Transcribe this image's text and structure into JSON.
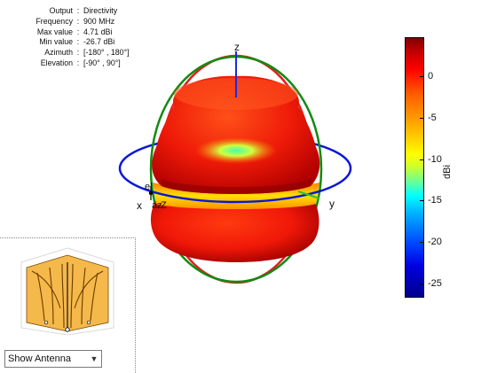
{
  "info": {
    "rows": [
      {
        "key": "Output",
        "sep": ":",
        "value": "Directivity"
      },
      {
        "key": "Frequency",
        "sep": ":",
        "value": "900 MHz"
      },
      {
        "key": "Max value",
        "sep": ":",
        "value": "4.71 dBi"
      },
      {
        "key": "Min value",
        "sep": ":",
        "value": "-26.7 dBi"
      },
      {
        "key": "Azimuth",
        "sep": ":",
        "value": "[-180° , 180°]"
      },
      {
        "key": "Elevation",
        "sep": ":",
        "value": "[-90° , 90°]"
      }
    ]
  },
  "axes": {
    "z": "z",
    "x": "x",
    "y": "y",
    "el": "el",
    "az": "az",
    "z2": "Z"
  },
  "colorbar": {
    "ticks": [
      "0",
      "-5",
      "-10",
      "-15",
      "-20",
      "-25"
    ],
    "unit": "dBi",
    "max": 4.71,
    "min": -26.7
  },
  "antenna_panel": {
    "dropdown_value": "Show Antenna",
    "arrow_icon": "chevron-down-icon"
  },
  "colors": {
    "azimuth_ring": "#0b17d6",
    "elevation_ring_xz": "#e02020",
    "elevation_ring_yz": "#128a12",
    "antenna_body": "#f5b84a"
  }
}
